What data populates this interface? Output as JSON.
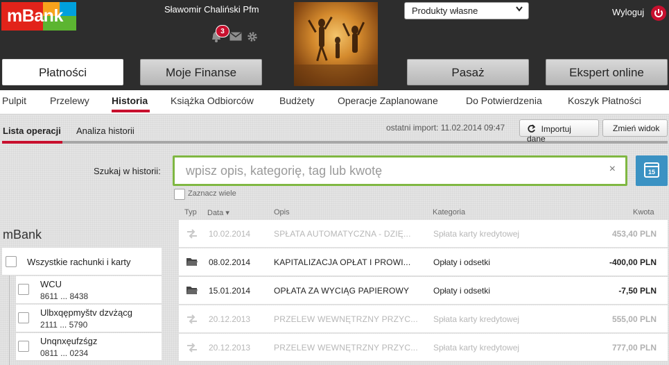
{
  "header": {
    "logo_text": "mBank",
    "username": "Sławomir Chaliński Pfm",
    "notification_count": "3",
    "products_select": "Produkty własne",
    "logout_label": "Wyloguj",
    "main_tabs": [
      {
        "label": "Płatności",
        "active": true
      },
      {
        "label": "Moje Finanse",
        "active": false
      },
      {
        "label": "Pasaż",
        "active": false
      },
      {
        "label": "Ekspert online",
        "active": false
      }
    ],
    "icons": [
      "bell-icon",
      "mail-icon",
      "gear-icon",
      "power-icon"
    ]
  },
  "subnav": {
    "items": [
      "Pulpit",
      "Przelewy",
      "Historia",
      "Książka Odbiorców",
      "Budżety",
      "Operacje Zaplanowane",
      "Do Potwierdzenia",
      "Koszyk Płatności"
    ],
    "active": "Historia"
  },
  "history": {
    "tabs": [
      "Lista operacji",
      "Analiza historii"
    ],
    "active_tab": "Lista operacji",
    "import_info": "ostatni import: 11.02.2014 09:47",
    "import_button": "Importuj dane",
    "view_button": "Zmień widok",
    "search_label": "Szukaj w historii:",
    "search_placeholder": "wpisz opis, kategorię, tag lub kwotę",
    "search_clear": "×",
    "calendar_day": "15",
    "multi_select_label": "Zaznacz wiele",
    "columns": {
      "type": "Typ",
      "date": "Data",
      "desc": "Opis",
      "category": "Kategoria",
      "amount": "Kwota"
    },
    "sort_indicator": "▾"
  },
  "accounts": {
    "title": "mBank",
    "all_label": "Wszystkie rachunki i karty",
    "items": [
      {
        "name": "WCU",
        "number": "8611 ... 8438"
      },
      {
        "name": "Ulbxqępmyštv dzvżącg",
        "number": "2111 ... 5790"
      },
      {
        "name": "Unqnxęufzśgz",
        "number": "0811 ... 0234"
      }
    ]
  },
  "operations": [
    {
      "icon": "transfer-icon",
      "date": "10.02.2014",
      "desc": "SPŁATA AUTOMATYCZNA - DZIĘ...",
      "category": "Spłata karty kredytowej",
      "amount": "453,40 PLN",
      "faded": true
    },
    {
      "icon": "folder-icon",
      "date": "08.02.2014",
      "desc": "KAPITALIZACJA OPŁAT I PROWI...",
      "category": "Opłaty i odsetki",
      "amount": "-400,00 PLN",
      "faded": false
    },
    {
      "icon": "folder-icon",
      "date": "15.01.2014",
      "desc": "OPŁATA ZA WYCIĄG PAPIEROWY",
      "category": "Opłaty i odsetki",
      "amount": "-7,50 PLN",
      "faded": false
    },
    {
      "icon": "transfer-icon",
      "date": "20.12.2013",
      "desc": "PRZELEW WEWNĘTRZNY PRZYC...",
      "category": "Spłata karty kredytowej",
      "amount": "555,00 PLN",
      "faded": true
    },
    {
      "icon": "transfer-icon",
      "date": "20.12.2013",
      "desc": "PRZELEW WEWNĘTRZNY PRZYC...",
      "category": "Spłata karty kredytowej",
      "amount": "777,00 PLN",
      "faded": true
    }
  ],
  "colors": {
    "brand_red": "#c8102e",
    "accent_green": "#7fb742",
    "calendar_blue": "#3b92c3"
  }
}
